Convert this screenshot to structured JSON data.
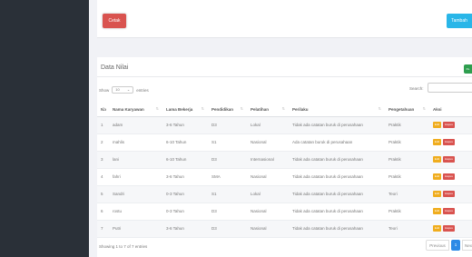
{
  "toolbar": {
    "cetak_label": "Cetak",
    "tambah_label": "Tambah"
  },
  "card": {
    "title": "Data Nilai",
    "badge_label": "Pe"
  },
  "length_control": {
    "show_label": "Show",
    "value": "10",
    "entries_label": "entries"
  },
  "search": {
    "label": "Search:",
    "value": ""
  },
  "table": {
    "columns": [
      "No",
      "Nama Karyawan",
      "Lama Bekerja",
      "Pendidikan",
      "Pelatihan",
      "Perilaku",
      "Pengetahuan",
      "Aksi"
    ],
    "rows": [
      [
        "1",
        "adam",
        "3-6 Tahun",
        "D3",
        "Lokal",
        "Tidak ada catatan buruk di perusahaan",
        "Praktik"
      ],
      [
        "2",
        "mahlis",
        "6-10 Tahun",
        "S1",
        "Nasional",
        "Ada catatan buruk di perusahaan",
        "Praktik"
      ],
      [
        "3",
        "lani",
        "6-10 Tahun",
        "D3",
        "Internasional",
        "Tidak ada catatan buruk di perusahaan",
        "Praktik"
      ],
      [
        "4",
        "fahri",
        "3-6 Tahun",
        "SMA",
        "Nasional",
        "Tidak ada catatan buruk di perusahaan",
        "Praktik"
      ],
      [
        "5",
        "Sandri",
        "0-3 Tahun",
        "S1",
        "Lokal",
        "Tidak ada catatan buruk di perusahaan",
        "Teori"
      ],
      [
        "6",
        "rostu",
        "0-3 Tahun",
        "D3",
        "Nasional",
        "Tidak ada catatan buruk di perusahaan",
        "Praktik"
      ],
      [
        "7",
        "Putri",
        "3-6 Tahun",
        "D3",
        "Nasional",
        "Tidak ada catatan buruk di perusahaan",
        "Teori"
      ]
    ],
    "action_edit": "Edit",
    "action_hapus": "Hapus"
  },
  "footer": {
    "info": "Showing 1 to 7 of 7 entries",
    "previous": "Previous",
    "current_page": "1",
    "next": "Next"
  },
  "colors": {
    "sidebar": "#2a3038",
    "cetak": "#d9534f",
    "tambah": "#29b6e8",
    "edit": "#f0ad1e",
    "hapus": "#d9534f",
    "active_page": "#2d8ae6"
  },
  "icons": {
    "sort": "sort-icon",
    "select_chevron": "chevron-down-icon"
  }
}
